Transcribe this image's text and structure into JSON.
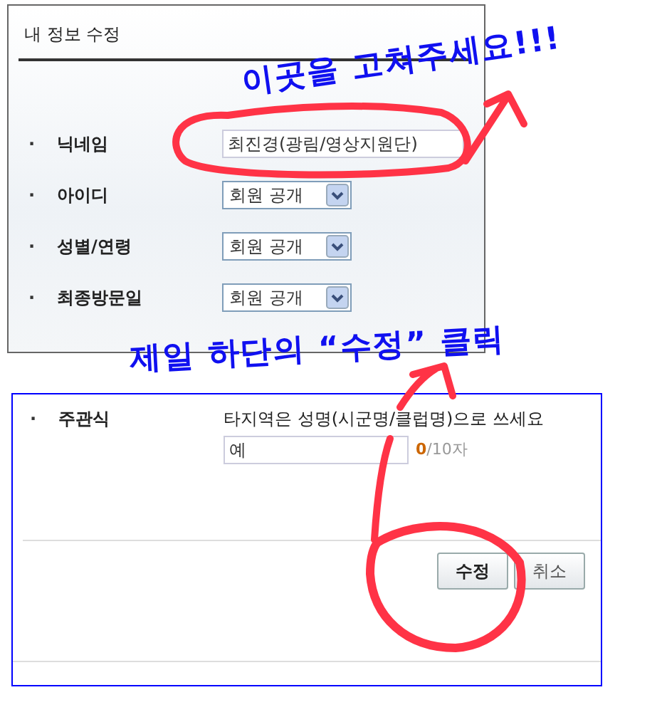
{
  "panel": {
    "title": "내 정보 수정",
    "bullet": "·",
    "fields": [
      {
        "kind": "text",
        "label": "닉네임",
        "value": "최진경(광림/영상지원단)"
      },
      {
        "kind": "select",
        "label": "아이디",
        "value": "회원 공개"
      },
      {
        "kind": "select",
        "label": "성별/연령",
        "value": "회원 공개"
      },
      {
        "kind": "select",
        "label": "최종방문일",
        "value": "회원 공개"
      }
    ]
  },
  "question": {
    "bullet": "·",
    "label": "주관식",
    "hint": "타지역은 성명(시군명/클럽명)으로 쓰세요",
    "value": "예",
    "count": "0",
    "limit": "/10자"
  },
  "buttons": [
    {
      "label": "수정",
      "kind": "primary"
    },
    {
      "label": "취소",
      "kind": "secondary"
    }
  ],
  "annotations": [
    {
      "text": "이곳을 고쳐주세요!!!"
    },
    {
      "text": "제일 하단의 “수정” 클릭"
    }
  ]
}
